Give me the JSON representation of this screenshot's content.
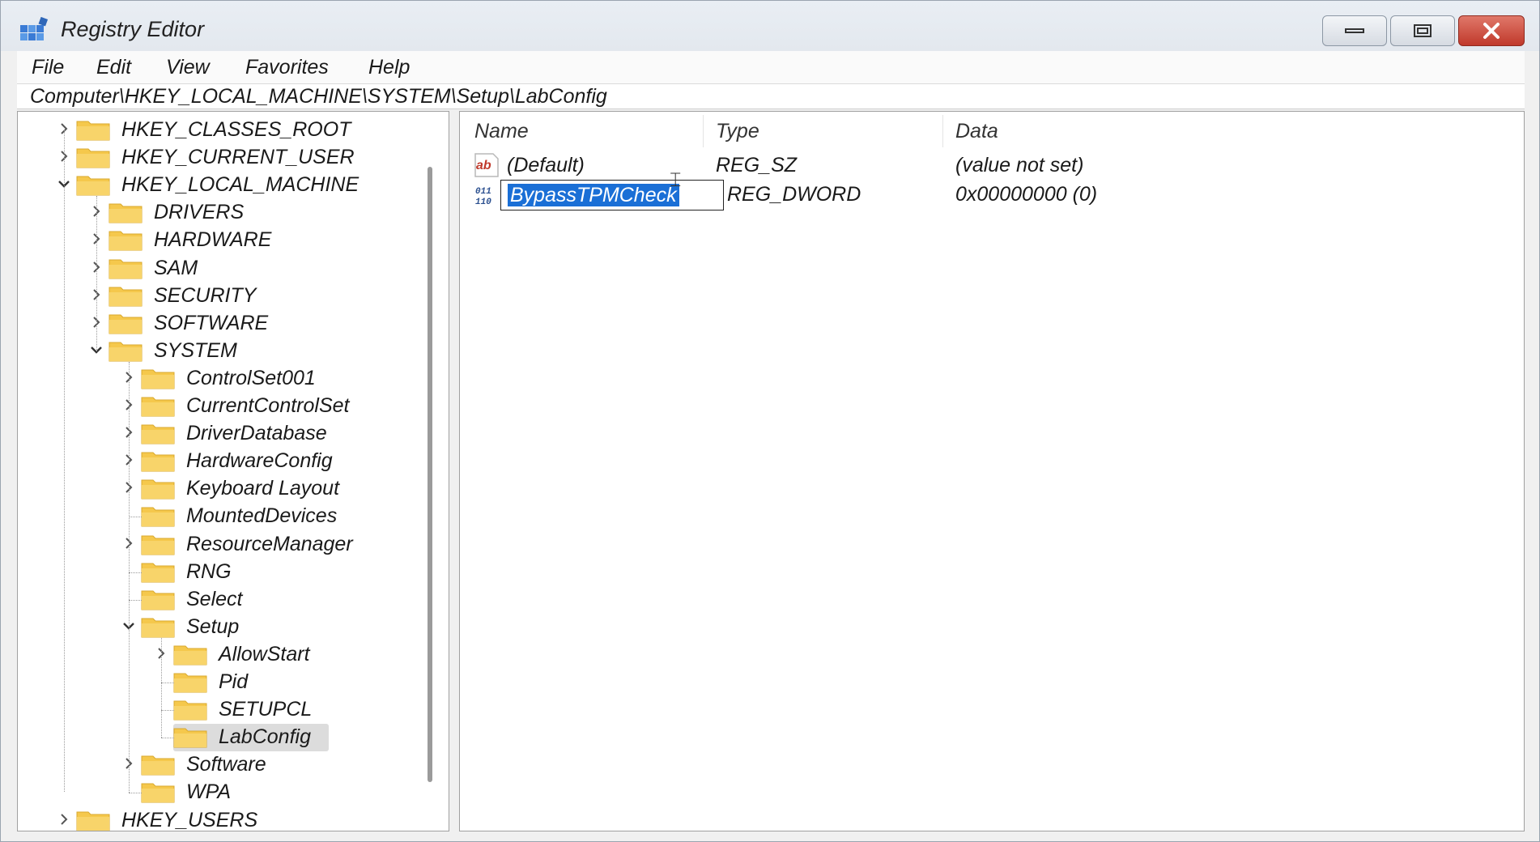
{
  "window": {
    "title": "Registry Editor",
    "controls": {
      "minimize": "minimize",
      "maximize": "maximize",
      "close": "close"
    }
  },
  "menu": [
    "File",
    "Edit",
    "View",
    "Favorites",
    "Help"
  ],
  "address": "Computer\\HKEY_LOCAL_MACHINE\\SYSTEM\\Setup\\LabConfig",
  "tree": [
    {
      "label": "HKEY_CLASSES_ROOT",
      "level": 0,
      "state": "collapsed"
    },
    {
      "label": "HKEY_CURRENT_USER",
      "level": 0,
      "state": "collapsed"
    },
    {
      "label": "HKEY_LOCAL_MACHINE",
      "level": 0,
      "state": "expanded"
    },
    {
      "label": "DRIVERS",
      "level": 1,
      "state": "collapsed"
    },
    {
      "label": "HARDWARE",
      "level": 1,
      "state": "collapsed"
    },
    {
      "label": "SAM",
      "level": 1,
      "state": "collapsed"
    },
    {
      "label": "SECURITY",
      "level": 1,
      "state": "collapsed"
    },
    {
      "label": "SOFTWARE",
      "level": 1,
      "state": "collapsed"
    },
    {
      "label": "SYSTEM",
      "level": 1,
      "state": "expanded"
    },
    {
      "label": "ControlSet001",
      "level": 2,
      "state": "collapsed"
    },
    {
      "label": "CurrentControlSet",
      "level": 2,
      "state": "collapsed"
    },
    {
      "label": "DriverDatabase",
      "level": 2,
      "state": "collapsed"
    },
    {
      "label": "HardwareConfig",
      "level": 2,
      "state": "collapsed"
    },
    {
      "label": "Keyboard Layout",
      "level": 2,
      "state": "collapsed"
    },
    {
      "label": "MountedDevices",
      "level": 2,
      "state": "leaf"
    },
    {
      "label": "ResourceManager",
      "level": 2,
      "state": "collapsed"
    },
    {
      "label": "RNG",
      "level": 2,
      "state": "leaf"
    },
    {
      "label": "Select",
      "level": 2,
      "state": "leaf"
    },
    {
      "label": "Setup",
      "level": 2,
      "state": "expanded"
    },
    {
      "label": "AllowStart",
      "level": 3,
      "state": "collapsed"
    },
    {
      "label": "Pid",
      "level": 3,
      "state": "leaf"
    },
    {
      "label": "SETUPCL",
      "level": 3,
      "state": "leaf"
    },
    {
      "label": "LabConfig",
      "level": 3,
      "state": "leaf",
      "selected": true
    },
    {
      "label": "Software",
      "level": 2,
      "state": "collapsed"
    },
    {
      "label": "WPA",
      "level": 2,
      "state": "leaf"
    },
    {
      "label": "HKEY_USERS",
      "level": 0,
      "state": "collapsed"
    }
  ],
  "columns": {
    "name": "Name",
    "type": "Type",
    "data": "Data"
  },
  "values": [
    {
      "name": "(Default)",
      "type": "REG_SZ",
      "data": "(value not set)",
      "icon": "string-value-icon",
      "icon_text": "ab"
    },
    {
      "name": "BypassTPMCheck",
      "type": "REG_DWORD",
      "data": "0x00000000 (0)",
      "icon": "binary-value-icon",
      "renaming": true
    }
  ],
  "colors": {
    "selection": "#1a6fd6",
    "folder": "#f5c84c",
    "close_button": "#c0392b"
  }
}
